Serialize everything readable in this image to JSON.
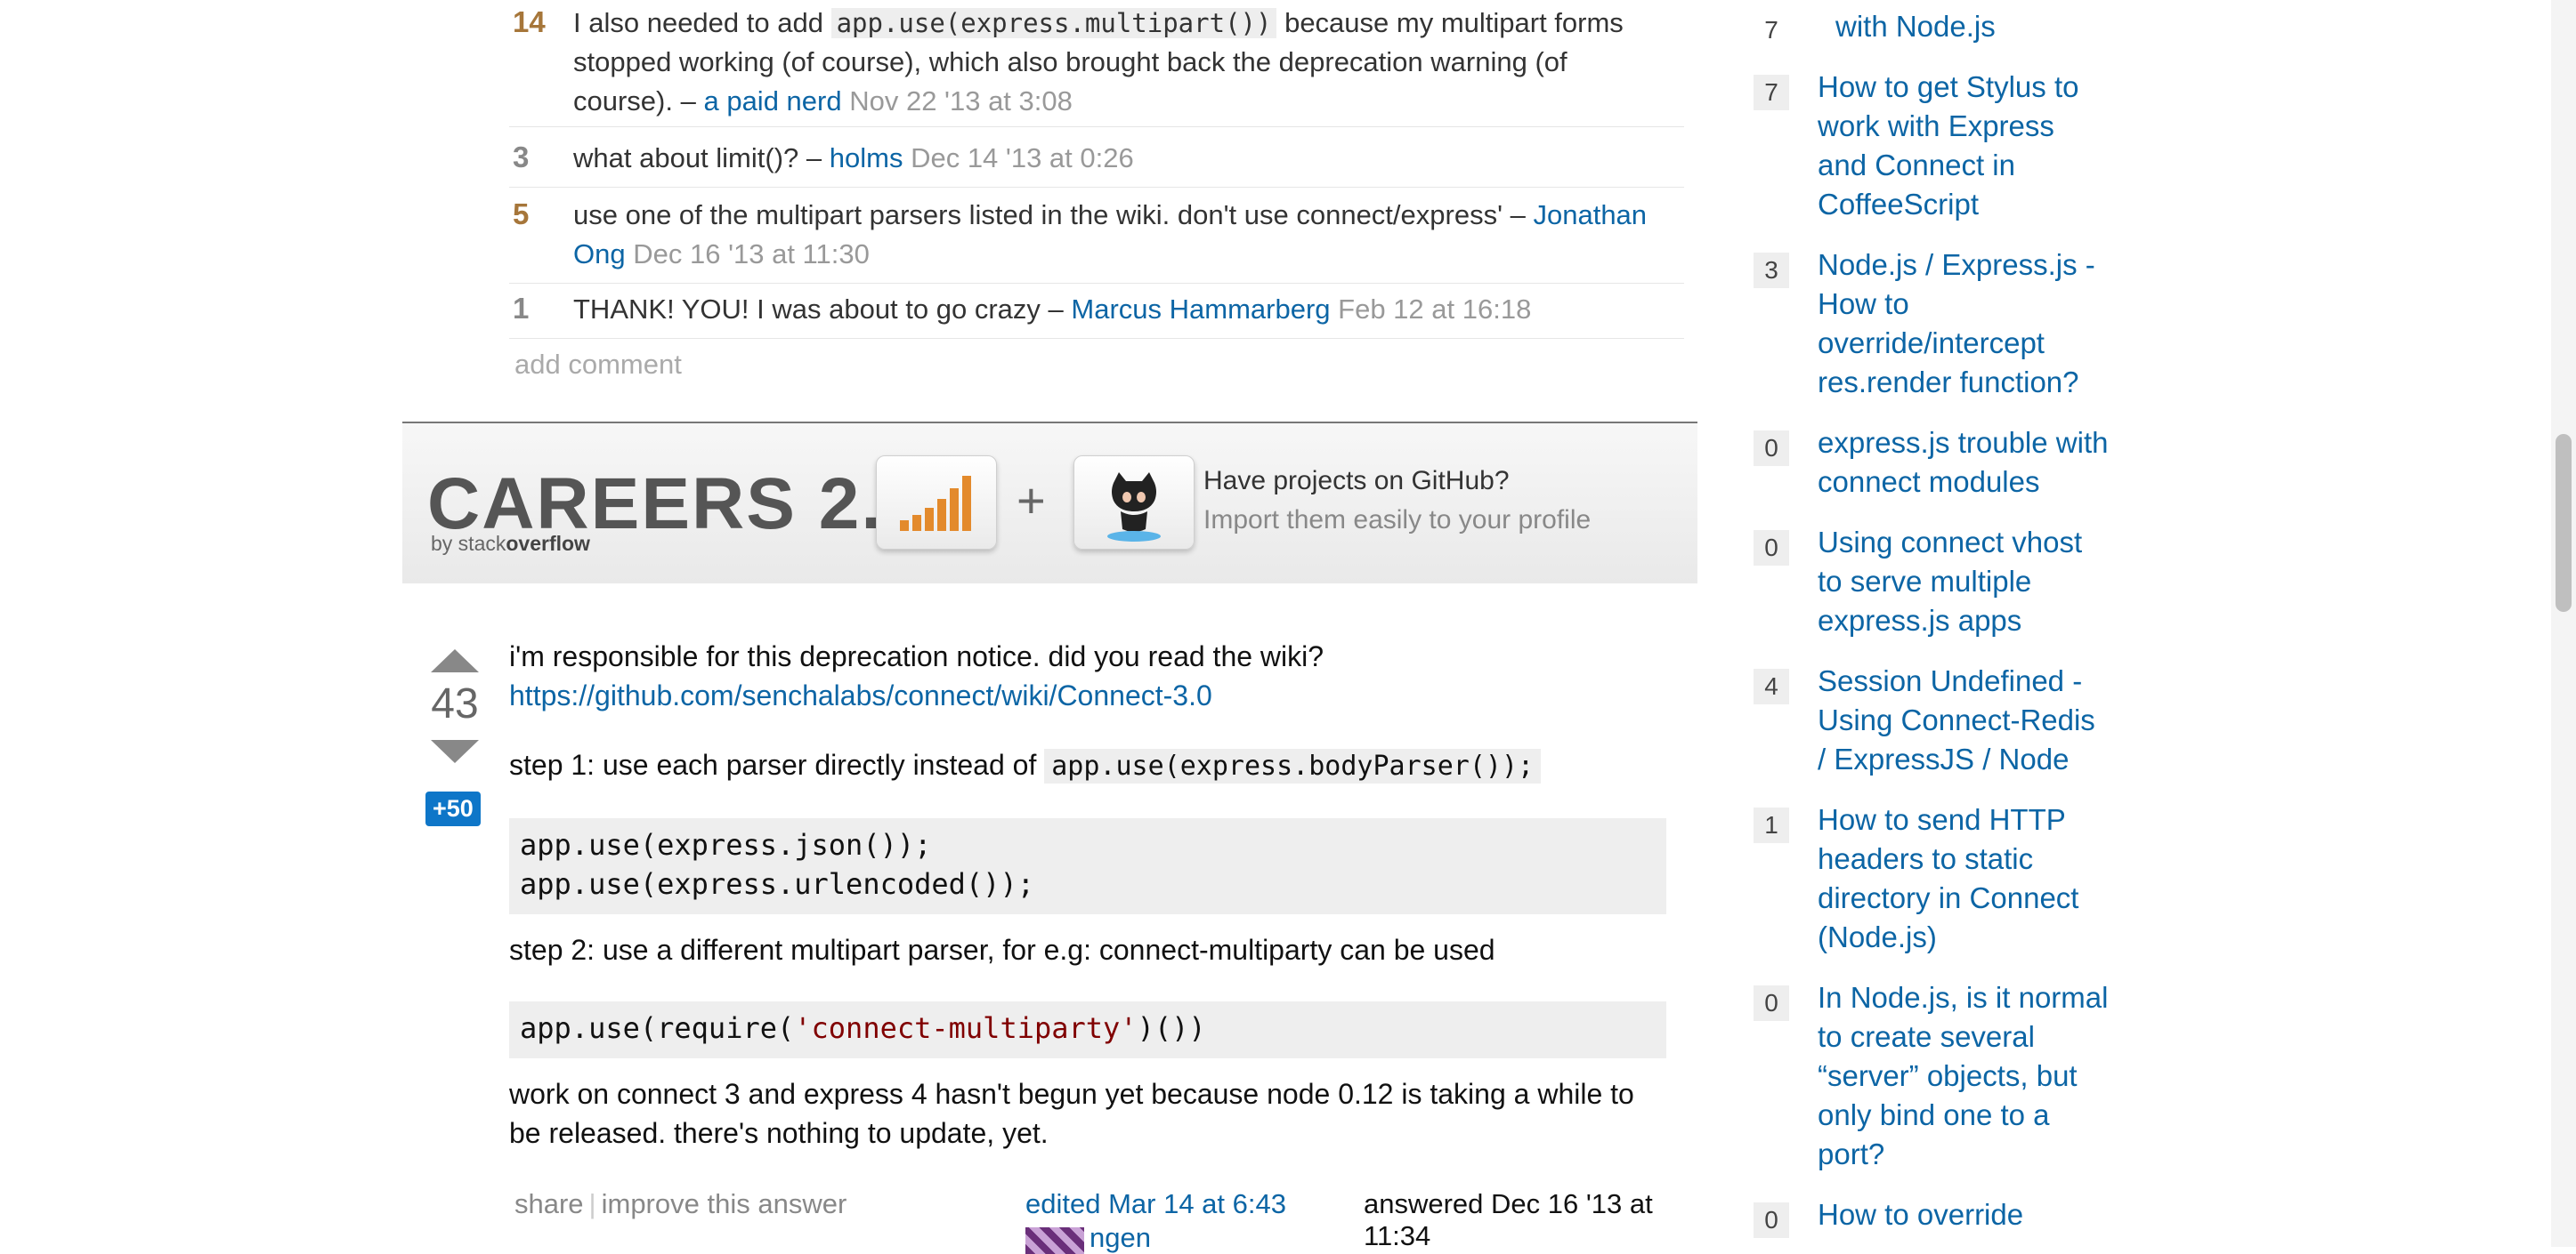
{
  "comments": [
    {
      "score": "14",
      "text_before": "I also needed to add",
      "code": "app.use(express.multipart())",
      "text_after": "because my multipart forms stopped working (of course), which also brought back the deprecation warning (of course). –",
      "user": "a paid nerd",
      "date": "Nov 22 '13 at 3:08"
    },
    {
      "score": "3",
      "text": "what about limit()? –",
      "user": "holms",
      "date": "Dec 14 '13 at 0:26"
    },
    {
      "score": "5",
      "text": "use one of the multipart parsers listed in the wiki. don't use connect/express' –",
      "user": "Jonathan Ong",
      "date": "Dec 16 '13 at 11:30"
    },
    {
      "score": "1",
      "text": "THANK! YOU! I was about to go crazy –",
      "user": "Marcus Hammarberg",
      "date": "Feb 12 at 16:18"
    }
  ],
  "add_comment": "add comment",
  "careers": {
    "logo": "CAREERS 2.0",
    "by_prefix": "by stack",
    "by_bold": "overflow",
    "plus": "+",
    "headline": "Have projects on GitHub?",
    "subline": "Import them easily to your profile"
  },
  "answer": {
    "vote_count": "43",
    "bounty": "+50",
    "p1": "i'm responsible for this deprecation notice. did you read the wiki?",
    "link": "https://github.com/senchalabs/connect/wiki/Connect-3.0",
    "step1_text": "step 1: use each parser directly instead of",
    "step1_code": "app.use(express.bodyParser());",
    "code1_line1": "app.use(express.json());",
    "code1_line2": "app.use(express.urlencoded());",
    "step2_text": "step 2: use a different multipart parser, for e.g: connect-multiparty can be used",
    "code2_pre": "app.use(require(",
    "code2_str": "'connect-multiparty'",
    "code2_post": ")())",
    "p_final": "work on connect 3 and express 4 hasn't begun yet because node 0.12 is taking a while to be released. there's nothing to update, yet.",
    "share": "share",
    "separator": "|",
    "improve": "improve this answer",
    "edited": "edited Mar 14 at 6:43",
    "editor": "ngen",
    "answered": "answered Dec 16 '13 at 11:34"
  },
  "sidebar": {
    "items": [
      {
        "score": "7",
        "title": "with Node.js"
      },
      {
        "score": "7",
        "title": "How to get Stylus to work with Express and Connect in CoffeeScript"
      },
      {
        "score": "3",
        "title": "Node.js / Express.js - How to override/intercept res.render function?"
      },
      {
        "score": "0",
        "title": "express.js trouble with connect modules"
      },
      {
        "score": "0",
        "title": "Using connect vhost to serve multiple express.js apps"
      },
      {
        "score": "4",
        "title": "Session Undefined - Using Connect-Redis / ExpressJS / Node"
      },
      {
        "score": "1",
        "title": "How to send HTTP headers to static directory in Connect (Node.js)"
      },
      {
        "score": "0",
        "title": "In Node.js, is it normal to create several “server” objects, but only bind one to a port?"
      },
      {
        "score": "0",
        "title": "How to override"
      }
    ]
  },
  "colors": {
    "link": "#0c65a5",
    "comment_score_hot": "#a6763a",
    "bounty": "#0e76c8"
  }
}
